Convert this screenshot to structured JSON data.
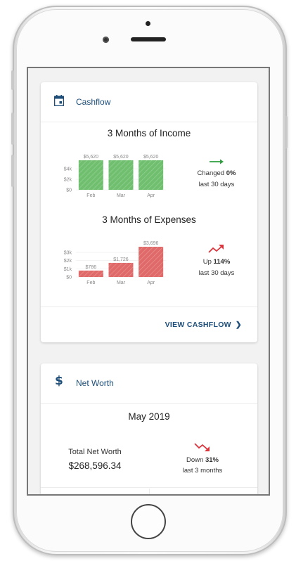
{
  "cashflow": {
    "title": "Cashflow",
    "income": {
      "title": "3 Months of Income",
      "y_ticks": [
        "$4k",
        "$2k",
        "$0"
      ],
      "months": [
        "Feb",
        "Mar",
        "Apr"
      ],
      "values": [
        5620,
        5620,
        5620
      ],
      "value_labels": [
        "$5,620",
        "$5,620",
        "$5,620"
      ],
      "change_prefix": "Changed",
      "change_pct": "0%",
      "period": "last 30 days",
      "color": "#6fbf6f"
    },
    "expenses": {
      "title": "3 Months of Expenses",
      "y_ticks": [
        "$3k",
        "$2k",
        "$1k",
        "$0"
      ],
      "months": [
        "Feb",
        "Mar",
        "Apr"
      ],
      "values": [
        786,
        1726,
        3696
      ],
      "value_labels": [
        "$786",
        "$1,726",
        "$3,696"
      ],
      "change_prefix": "Up",
      "change_pct": "114%",
      "period": "last 30 days",
      "color": "#e06a6a"
    },
    "view_link": "VIEW CASHFLOW"
  },
  "net_worth": {
    "title": "Net Worth",
    "period": "May 2019",
    "total_label": "Total Net Worth",
    "total_value": "$268,596.34",
    "change_prefix": "Down",
    "change_pct": "31%",
    "change_period": "last 3 months"
  },
  "colors": {
    "accent": "#1d4e7a",
    "up_green": "#2e9e3e",
    "down_red": "#d9363e"
  }
}
